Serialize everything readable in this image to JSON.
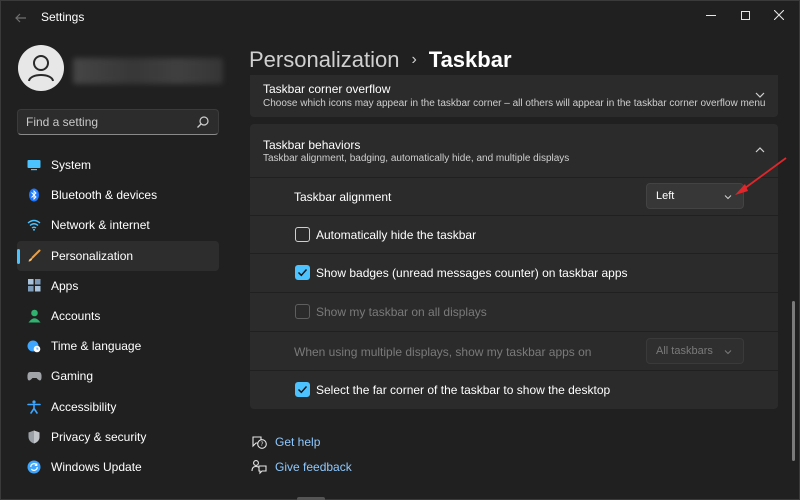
{
  "window": {
    "title": "Settings",
    "back_icon": "back-arrow-icon",
    "controls": [
      "minimize-icon",
      "maximize-icon",
      "close-icon"
    ]
  },
  "search": {
    "placeholder": "Find a setting",
    "value": ""
  },
  "nav": {
    "items": [
      {
        "id": "system",
        "label": "System",
        "icon": "monitor-icon",
        "color": "#4cc2ff",
        "active": false
      },
      {
        "id": "bluetooth",
        "label": "Bluetooth & devices",
        "icon": "bluetooth-icon",
        "color": "#1e90ff",
        "active": false
      },
      {
        "id": "network",
        "label": "Network & internet",
        "icon": "wifi-icon",
        "color": "#4cc2ff",
        "active": false
      },
      {
        "id": "personalization",
        "label": "Personalization",
        "icon": "paintbrush-icon",
        "color": "#e8a04c",
        "active": true
      },
      {
        "id": "apps",
        "label": "Apps",
        "icon": "apps-icon",
        "color": "#8aa8c8",
        "active": false
      },
      {
        "id": "accounts",
        "label": "Accounts",
        "icon": "person-icon",
        "color": "#2fb36f",
        "active": false
      },
      {
        "id": "time",
        "label": "Time & language",
        "icon": "globe-clock-icon",
        "color": "#3ea6ff",
        "active": false
      },
      {
        "id": "gaming",
        "label": "Gaming",
        "icon": "gamepad-icon",
        "color": "#9aa0a6",
        "active": false
      },
      {
        "id": "accessibility",
        "label": "Accessibility",
        "icon": "accessibility-icon",
        "color": "#3ea6ff",
        "active": false
      },
      {
        "id": "privacy",
        "label": "Privacy & security",
        "icon": "shield-icon",
        "color": "#9aa0a6",
        "active": false
      },
      {
        "id": "update",
        "label": "Windows Update",
        "icon": "sync-icon",
        "color": "#3ea6ff",
        "active": false
      }
    ]
  },
  "breadcrumb": {
    "parent": "Personalization",
    "separator": "›",
    "current": "Taskbar"
  },
  "sections": {
    "overflow": {
      "title": "Taskbar corner overflow",
      "subtitle": "Choose which icons may appear in the taskbar corner – all others will appear in the taskbar corner overflow menu",
      "expanded": false
    },
    "behaviors": {
      "title": "Taskbar behaviors",
      "subtitle": "Taskbar alignment, badging, automatically hide, and multiple displays",
      "expanded": true,
      "alignment": {
        "label": "Taskbar alignment",
        "value": "Left"
      },
      "auto_hide": {
        "label": "Automatically hide the taskbar",
        "checked": false
      },
      "badges": {
        "label": "Show badges (unread messages counter) on taskbar apps",
        "checked": true
      },
      "all_displays": {
        "label": "Show my taskbar on all displays",
        "checked": false,
        "disabled": true
      },
      "multi_display": {
        "label": "When using multiple displays, show my taskbar apps on",
        "value": "All taskbars",
        "disabled": true
      },
      "far_corner": {
        "label": "Select the far corner of the taskbar to show the desktop",
        "checked": true
      }
    }
  },
  "links": {
    "help": {
      "label": "Get help",
      "icon": "help-icon"
    },
    "feedback": {
      "label": "Give feedback",
      "icon": "feedback-icon"
    }
  },
  "colors": {
    "accent": "#4cc2ff",
    "background": "#202020",
    "card": "#2b2b2b",
    "annotation_arrow": "#e0262b"
  }
}
